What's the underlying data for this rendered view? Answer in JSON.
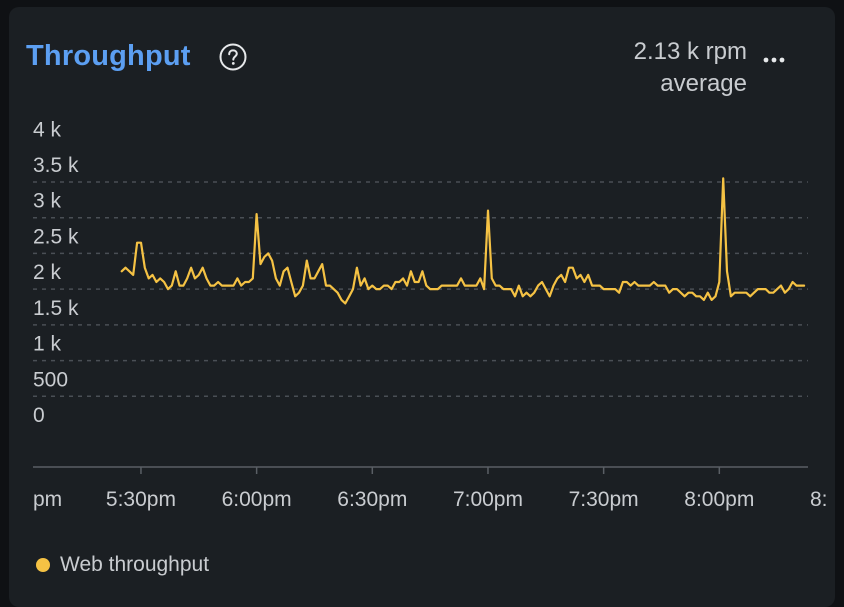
{
  "widget": {
    "title": "Throughput",
    "summary_value": "2.13 k rpm",
    "summary_label": "average",
    "help_icon": "question-circle-icon",
    "more_icon": "more-horizontal-icon"
  },
  "colors": {
    "accent": "#5c9ff2",
    "series": "#f5c244",
    "text": "#c9ccd0",
    "grid": "#4a4f55",
    "card": "#1b1f23"
  },
  "legend": [
    {
      "label": "Web throughput",
      "color": "#f5c244"
    }
  ],
  "chart_data": {
    "type": "line",
    "y_ticks": [
      {
        "value": 0,
        "label": "0"
      },
      {
        "value": 500,
        "label": "500"
      },
      {
        "value": 1000,
        "label": "1 k"
      },
      {
        "value": 1500,
        "label": "1.5 k"
      },
      {
        "value": 2000,
        "label": "2 k"
      },
      {
        "value": 2500,
        "label": "2.5 k"
      },
      {
        "value": 3000,
        "label": "3 k"
      },
      {
        "value": 3500,
        "label": "3.5 k"
      },
      {
        "value": 4000,
        "label": "4 k"
      }
    ],
    "ylim": [
      0,
      4000
    ],
    "x_ticks": [
      "pm",
      "5:30pm",
      "6:00pm",
      "6:30pm",
      "7:00pm",
      "7:30pm",
      "8:00pm",
      "8:"
    ],
    "x_tick_minutes": [
      -30,
      0,
      30,
      60,
      90,
      120,
      150,
      180
    ],
    "x_minutes_range": [
      -28,
      173
    ],
    "grid": true,
    "legend_position": "bottom-left",
    "series": [
      {
        "name": "Web throughput",
        "color": "#f5c244",
        "points": [
          [
            -5.0,
            2250
          ],
          [
            -4.0,
            2300
          ],
          [
            -3.0,
            2250
          ],
          [
            -2.0,
            2200
          ],
          [
            -1.0,
            2650
          ],
          [
            0.0,
            2650
          ],
          [
            1.0,
            2300
          ],
          [
            2.0,
            2150
          ],
          [
            3.0,
            2200
          ],
          [
            4.0,
            2100
          ],
          [
            5.0,
            2150
          ],
          [
            6.0,
            2100
          ],
          [
            7.0,
            2000
          ],
          [
            8.0,
            2050
          ],
          [
            9.0,
            2250
          ],
          [
            10.0,
            2050
          ],
          [
            11.0,
            2050
          ],
          [
            12.0,
            2150
          ],
          [
            13.0,
            2300
          ],
          [
            14.0,
            2150
          ],
          [
            15.0,
            2200
          ],
          [
            16.0,
            2300
          ],
          [
            17.0,
            2150
          ],
          [
            18.0,
            2050
          ],
          [
            19.0,
            2050
          ],
          [
            20.0,
            2100
          ],
          [
            21.0,
            2050
          ],
          [
            22.0,
            2050
          ],
          [
            23.0,
            2050
          ],
          [
            24.0,
            2050
          ],
          [
            25.0,
            2150
          ],
          [
            26.0,
            2050
          ],
          [
            27.0,
            2100
          ],
          [
            28.0,
            2100
          ],
          [
            29.0,
            2150
          ],
          [
            30.0,
            3050
          ],
          [
            31.0,
            2350
          ],
          [
            32.0,
            2450
          ],
          [
            33.0,
            2500
          ],
          [
            34.0,
            2400
          ],
          [
            35.0,
            2150
          ],
          [
            36.0,
            2050
          ],
          [
            37.0,
            2250
          ],
          [
            38.0,
            2300
          ],
          [
            39.0,
            2100
          ],
          [
            40.0,
            1900
          ],
          [
            41.0,
            1950
          ],
          [
            42.0,
            2050
          ],
          [
            43.0,
            2400
          ],
          [
            44.0,
            2150
          ],
          [
            45.0,
            2150
          ],
          [
            46.0,
            2250
          ],
          [
            47.0,
            2350
          ],
          [
            48.0,
            2050
          ],
          [
            49.0,
            2050
          ],
          [
            50.0,
            2000
          ],
          [
            51.0,
            1950
          ],
          [
            52.0,
            1850
          ],
          [
            53.0,
            1800
          ],
          [
            54.0,
            1900
          ],
          [
            55.0,
            2000
          ],
          [
            56.0,
            2300
          ],
          [
            57.0,
            2050
          ],
          [
            58.0,
            2150
          ],
          [
            59.0,
            2000
          ],
          [
            60.0,
            2050
          ],
          [
            61.0,
            2000
          ],
          [
            62.0,
            2000
          ],
          [
            63.0,
            2050
          ],
          [
            64.0,
            2050
          ],
          [
            65.0,
            2000
          ],
          [
            66.0,
            2100
          ],
          [
            67.0,
            2100
          ],
          [
            68.0,
            2150
          ],
          [
            69.0,
            2050
          ],
          [
            70.0,
            2250
          ],
          [
            71.0,
            2100
          ],
          [
            72.0,
            2100
          ],
          [
            73.0,
            2250
          ],
          [
            74.0,
            2050
          ],
          [
            75.0,
            2000
          ],
          [
            76.0,
            2000
          ],
          [
            77.0,
            2000
          ],
          [
            78.0,
            2050
          ],
          [
            79.0,
            2050
          ],
          [
            80.0,
            2050
          ],
          [
            81.0,
            2050
          ],
          [
            82.0,
            2050
          ],
          [
            83.0,
            2150
          ],
          [
            84.0,
            2050
          ],
          [
            85.0,
            2050
          ],
          [
            86.0,
            2050
          ],
          [
            87.0,
            2050
          ],
          [
            88.0,
            2150
          ],
          [
            89.0,
            2000
          ],
          [
            90.0,
            3100
          ],
          [
            91.0,
            2150
          ],
          [
            92.0,
            2050
          ],
          [
            93.0,
            2050
          ],
          [
            94.0,
            2000
          ],
          [
            95.0,
            2000
          ],
          [
            96.0,
            2000
          ],
          [
            97.0,
            1900
          ],
          [
            98.0,
            2050
          ],
          [
            99.0,
            1900
          ],
          [
            100.0,
            1950
          ],
          [
            101.0,
            1900
          ],
          [
            102.0,
            1950
          ],
          [
            103.0,
            2050
          ],
          [
            104.0,
            2100
          ],
          [
            105.0,
            2000
          ],
          [
            106.0,
            1900
          ],
          [
            107.0,
            2050
          ],
          [
            108.0,
            2150
          ],
          [
            109.0,
            2200
          ],
          [
            110.0,
            2100
          ],
          [
            111.0,
            2300
          ],
          [
            112.0,
            2300
          ],
          [
            113.0,
            2150
          ],
          [
            114.0,
            2200
          ],
          [
            115.0,
            2100
          ],
          [
            116.0,
            2200
          ],
          [
            117.0,
            2050
          ],
          [
            118.0,
            2050
          ],
          [
            119.0,
            2050
          ],
          [
            120.0,
            2000
          ],
          [
            121.0,
            2000
          ],
          [
            122.0,
            2000
          ],
          [
            123.0,
            2000
          ],
          [
            124.0,
            1950
          ],
          [
            125.0,
            2100
          ],
          [
            126.0,
            2100
          ],
          [
            127.0,
            2050
          ],
          [
            128.0,
            2100
          ],
          [
            129.0,
            2050
          ],
          [
            130.0,
            2050
          ],
          [
            131.0,
            2050
          ],
          [
            132.0,
            2050
          ],
          [
            133.0,
            2100
          ],
          [
            134.0,
            2050
          ],
          [
            135.0,
            2050
          ],
          [
            136.0,
            2050
          ],
          [
            137.0,
            1950
          ],
          [
            138.0,
            2000
          ],
          [
            139.0,
            2000
          ],
          [
            140.0,
            1950
          ],
          [
            141.0,
            1900
          ],
          [
            142.0,
            1950
          ],
          [
            143.0,
            1950
          ],
          [
            144.0,
            1900
          ],
          [
            145.0,
            1900
          ],
          [
            146.0,
            1850
          ],
          [
            147.0,
            1950
          ],
          [
            148.0,
            1850
          ],
          [
            149.0,
            1900
          ],
          [
            150.0,
            2100
          ],
          [
            151.0,
            3550
          ],
          [
            152.0,
            2250
          ],
          [
            153.0,
            1900
          ],
          [
            154.0,
            1950
          ],
          [
            155.0,
            1950
          ],
          [
            156.0,
            1950
          ],
          [
            157.0,
            1950
          ],
          [
            158.0,
            1900
          ],
          [
            159.0,
            1950
          ],
          [
            160.0,
            2000
          ],
          [
            161.0,
            2000
          ],
          [
            162.0,
            2000
          ],
          [
            163.0,
            1950
          ],
          [
            164.0,
            1950
          ],
          [
            165.0,
            2000
          ],
          [
            166.0,
            2050
          ],
          [
            167.0,
            1950
          ],
          [
            168.0,
            2000
          ],
          [
            169.0,
            2100
          ],
          [
            170.0,
            2050
          ],
          [
            171.0,
            2050
          ],
          [
            172.0,
            2050
          ]
        ]
      }
    ]
  }
}
